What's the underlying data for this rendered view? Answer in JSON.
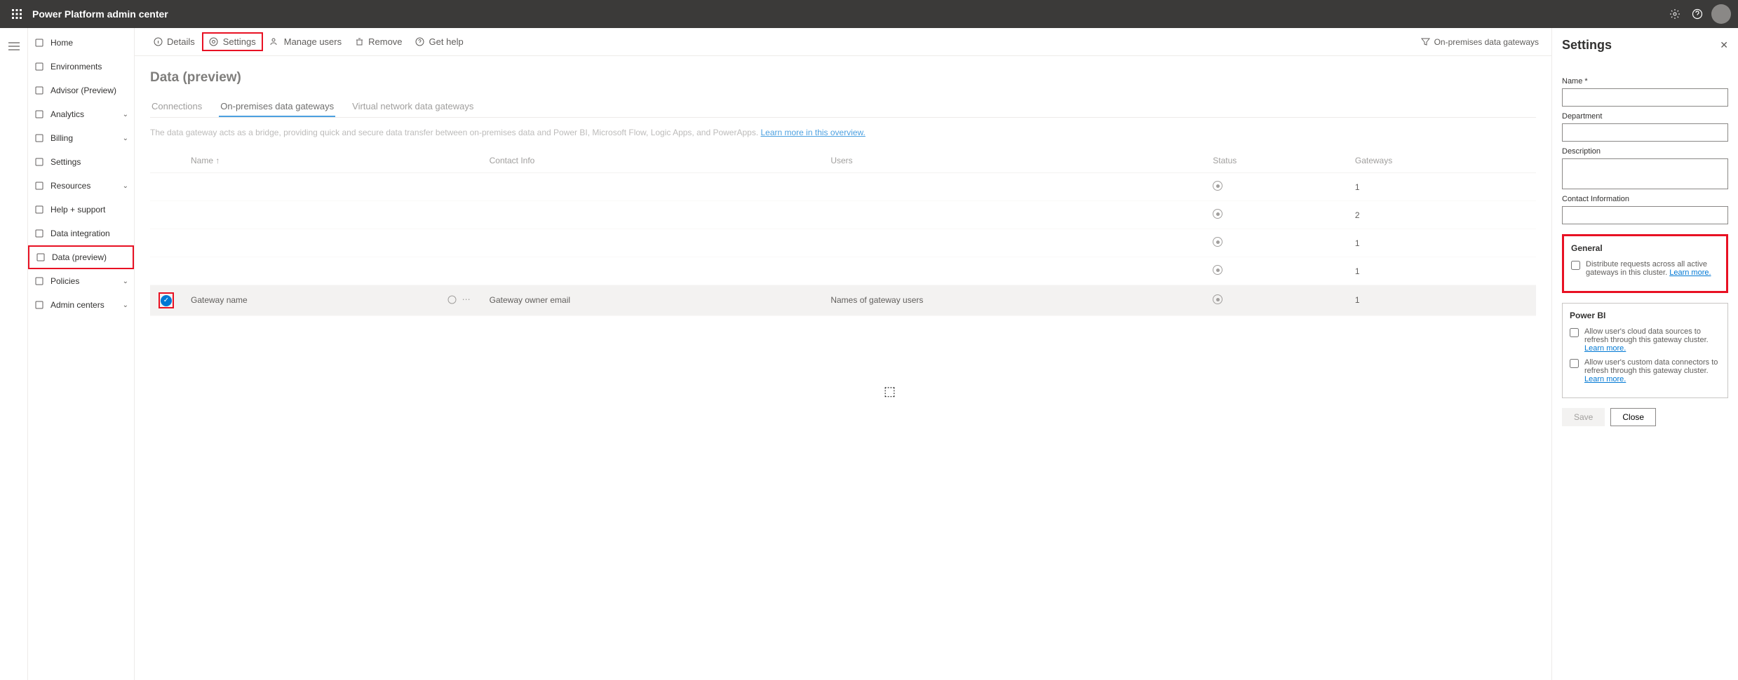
{
  "app_title": "Power Platform admin center",
  "sidebar": {
    "items": [
      {
        "label": "Home",
        "icon": "home"
      },
      {
        "label": "Environments",
        "icon": "env"
      },
      {
        "label": "Advisor (Preview)",
        "icon": "advisor"
      },
      {
        "label": "Analytics",
        "icon": "analytics",
        "chev": true
      },
      {
        "label": "Billing",
        "icon": "billing",
        "chev": true
      },
      {
        "label": "Settings",
        "icon": "settings"
      },
      {
        "label": "Resources",
        "icon": "resources",
        "chev": true
      },
      {
        "label": "Help + support",
        "icon": "help"
      },
      {
        "label": "Data integration",
        "icon": "dataint"
      },
      {
        "label": "Data (preview)",
        "icon": "datap",
        "selected": true,
        "highlight": true
      },
      {
        "label": "Policies",
        "icon": "policies",
        "chev": true
      },
      {
        "label": "Admin centers",
        "icon": "admin",
        "chev": true
      }
    ]
  },
  "cmdbar": {
    "details": "Details",
    "settings": "Settings",
    "manage_users": "Manage users",
    "remove": "Remove",
    "get_help": "Get help",
    "right": "On-premises data gateways"
  },
  "page": {
    "title": "Data (preview)",
    "tabs": {
      "connections": "Connections",
      "onprem": "On-premises data gateways",
      "vnet": "Virtual network data gateways"
    },
    "desc_text": "The data gateway acts as a bridge, providing quick and secure data transfer between on-premises data and Power BI, Microsoft Flow, Logic Apps, and PowerApps. ",
    "desc_link": "Learn more in this overview.",
    "columns": {
      "name": "Name ↑",
      "contact": "Contact Info",
      "users": "Users",
      "status": "Status",
      "gateways": "Gateways"
    },
    "rows": [
      {
        "name": "",
        "contact": "",
        "users": "",
        "gw": "1"
      },
      {
        "name": "",
        "contact": "",
        "users": "",
        "gw": "2"
      },
      {
        "name": "",
        "contact": "",
        "users": "",
        "gw": "1"
      },
      {
        "name": "",
        "contact": "",
        "users": "",
        "gw": "1"
      },
      {
        "name": "Gateway name",
        "contact": "Gateway owner email",
        "users": "Names of gateway users",
        "gw": "1",
        "sel": true
      }
    ]
  },
  "panel": {
    "title": "Settings",
    "name_label": "Name *",
    "name_value": "",
    "dept_label": "Department",
    "dept_value": "",
    "desc_label": "Description",
    "desc_value": "",
    "contact_label": "Contact Information",
    "contact_value": "",
    "general": {
      "title": "General",
      "cb": "Distribute requests across all active gateways in this cluster.",
      "lm": "Learn more."
    },
    "powerbi": {
      "title": "Power BI",
      "cb1": "Allow user's cloud data sources to refresh through this gateway cluster.",
      "lm1": "Learn more.",
      "cb2": "Allow user's custom data connectors to refresh through this gateway cluster.",
      "lm2": "Learn more."
    },
    "save": "Save",
    "close": "Close"
  }
}
